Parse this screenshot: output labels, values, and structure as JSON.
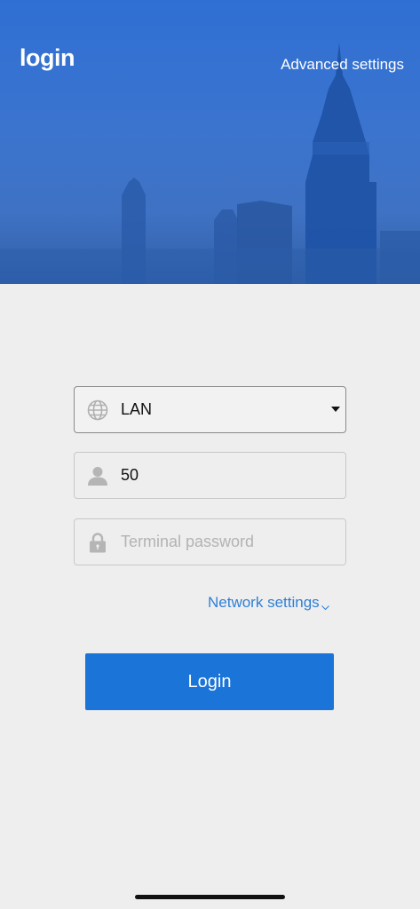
{
  "header": {
    "title": "login",
    "advanced_label": "Advanced settings"
  },
  "form": {
    "connection_type": {
      "value": "LAN",
      "icon": "globe-icon"
    },
    "terminal_id": {
      "value": "50",
      "icon": "user-icon"
    },
    "password": {
      "placeholder": "Terminal password",
      "icon": "lock-icon"
    }
  },
  "network_settings_label": "Network settings",
  "login_button_label": "Login",
  "colors": {
    "accent": "#1b74d8",
    "link": "#2f7fd6",
    "header_bg": "#3b74cf",
    "page_bg": "#eeeeee"
  }
}
